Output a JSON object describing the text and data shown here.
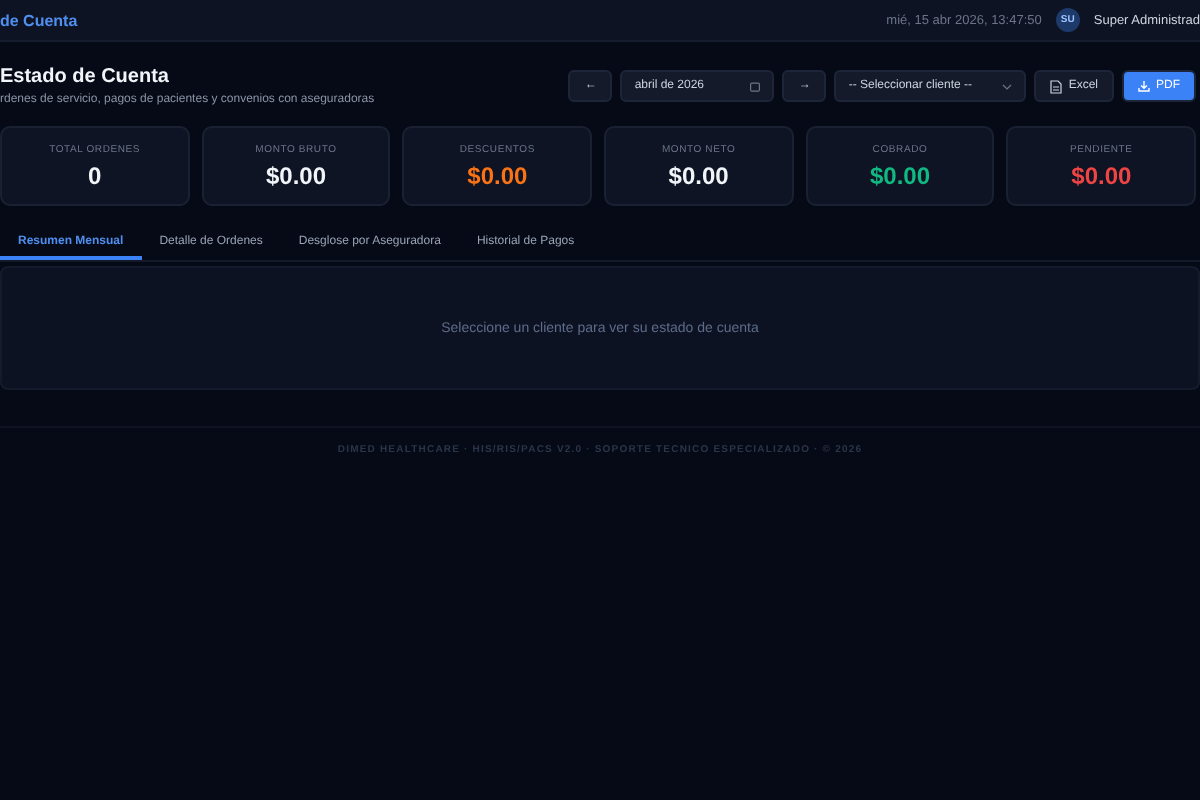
{
  "topbar": {
    "title": "de Cuenta",
    "datetime": "mié, 15 abr 2026, 13:47:50",
    "user_initials": "SU",
    "user_name": "Super Administrad"
  },
  "header": {
    "title": "Estado de Cuenta",
    "subtitle": "rdenes de servicio, pagos de pacientes y convenios con aseguradoras"
  },
  "toolbar": {
    "prev": "←",
    "month": "abril de 2026",
    "next": "→",
    "client_select": "-- Seleccionar cliente --",
    "excel": "Excel",
    "pdf": "PDF"
  },
  "stats": [
    {
      "label": "TOTAL ORDENES",
      "value": "0",
      "color": "#f1f5f9"
    },
    {
      "label": "MONTO BRUTO",
      "value": "$0.00",
      "color": "#f1f5f9"
    },
    {
      "label": "DESCUENTOS",
      "value": "$0.00",
      "color": "#f97316"
    },
    {
      "label": "MONTO NETO",
      "value": "$0.00",
      "color": "#f1f5f9"
    },
    {
      "label": "COBRADO",
      "value": "$0.00",
      "color": "#10b981"
    },
    {
      "label": "PENDIENTE",
      "value": "$0.00",
      "color": "#ef4444"
    }
  ],
  "tabs": [
    {
      "label": "Resumen Mensual",
      "selected": true
    },
    {
      "label": "Detalle de Ordenes",
      "selected": false
    },
    {
      "label": "Desglose por Aseguradora",
      "selected": false
    },
    {
      "label": "Historial de Pagos",
      "selected": false
    }
  ],
  "empty_message": "Seleccione un cliente para ver su estado de cuenta",
  "footer": "DIMED HEALTHCARE · HIS/RIS/PACS V2.0 · SOPORTE TECNICO ESPECIALIZADO · © 2026"
}
